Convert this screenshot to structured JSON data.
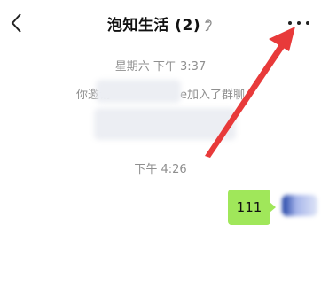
{
  "header": {
    "title": "泡知生活 (2)",
    "back_icon": "chevron-left-icon",
    "ear_icon": "ear-icon",
    "more_icon": "more-dots-icon"
  },
  "messages": {
    "time_1": "星期六 下午 3:37",
    "invite_notice_start": "你邀请",
    "invite_notice_mid": "e",
    "invite_notice_end": "加入了群聊",
    "time_2": "下午 4:26",
    "my_message": "111"
  },
  "colors": {
    "bubble": "#a0e75a",
    "annotation_arrow": "#e83a3a",
    "system_text": "#8f8f8f"
  }
}
